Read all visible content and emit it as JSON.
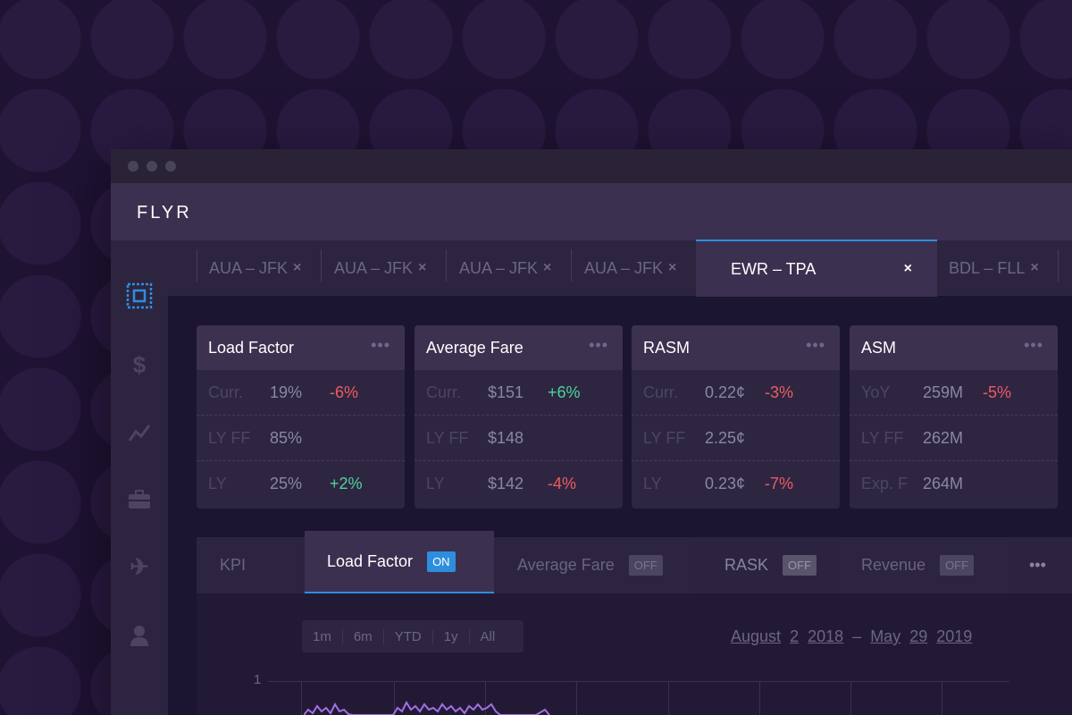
{
  "app": {
    "logo": "FLYR"
  },
  "route_tabs": [
    {
      "label": "AUA – JFK",
      "close": "×"
    },
    {
      "label": "AUA – JFK",
      "close": "×"
    },
    {
      "label": "AUA – JFK",
      "close": "×"
    },
    {
      "label": "AUA – JFK",
      "close": "×"
    },
    {
      "label": "EWR – TPA",
      "close": "×",
      "active": true
    },
    {
      "label": "BDL – FLL",
      "close": "×"
    }
  ],
  "sidebar": {
    "items": [
      {
        "icon": "dashboard-icon",
        "active": true
      },
      {
        "icon": "dollar-icon"
      },
      {
        "icon": "trend-icon"
      },
      {
        "icon": "briefcase-icon"
      },
      {
        "icon": "plane-icon"
      },
      {
        "icon": "user-icon"
      }
    ]
  },
  "cards": [
    {
      "title": "Load Factor",
      "more": "•••",
      "rows": [
        {
          "label": "Curr.",
          "value": "19%",
          "change": "-6%",
          "trend": "neg"
        },
        {
          "label": "LY FF",
          "value": "85%",
          "change": "",
          "trend": ""
        },
        {
          "label": "LY",
          "value": "25%",
          "change": "+2%",
          "trend": "pos"
        }
      ]
    },
    {
      "title": "Average Fare",
      "more": "•••",
      "rows": [
        {
          "label": "Curr.",
          "value": "$151",
          "change": "+6%",
          "trend": "pos"
        },
        {
          "label": "LY FF",
          "value": "$148",
          "change": "",
          "trend": ""
        },
        {
          "label": "LY",
          "value": "$142",
          "change": "-4%",
          "trend": "neg"
        }
      ]
    },
    {
      "title": "RASM",
      "more": "•••",
      "rows": [
        {
          "label": "Curr.",
          "value": "0.22¢",
          "change": "-3%",
          "trend": "neg"
        },
        {
          "label": "LY FF",
          "value": "2.25¢",
          "change": "",
          "trend": ""
        },
        {
          "label": "LY",
          "value": "0.23¢",
          "change": "-7%",
          "trend": "neg"
        }
      ]
    },
    {
      "title": "ASM",
      "more": "•••",
      "rows": [
        {
          "label": "YoY",
          "value": "259M",
          "change": "-5%",
          "trend": "neg"
        },
        {
          "label": "LY FF",
          "value": "262M",
          "change": "",
          "trend": ""
        },
        {
          "label": "Exp. F",
          "value": "264M",
          "change": "",
          "trend": ""
        }
      ]
    }
  ],
  "kpi_tabs": {
    "kpi_label": "KPI",
    "items": [
      {
        "label": "Load Factor",
        "state": "ON"
      },
      {
        "label": "Average Fare",
        "state": "OFF"
      },
      {
        "label": "RASK",
        "state": "OFF"
      },
      {
        "label": "Revenue",
        "state": "OFF"
      }
    ],
    "more": "•••"
  },
  "ranges": [
    "1m",
    "6m",
    "YTD",
    "1y",
    "All"
  ],
  "date_range": {
    "from_month": "August",
    "from_day": "2",
    "from_year": "2018",
    "sep": "–",
    "to_month": "May",
    "to_day": "29",
    "to_year": "2019"
  },
  "chart": {
    "y_tick": "1"
  },
  "colors": {
    "accent": "#2e8ede",
    "negative": "#ee5a64",
    "positive": "#4ed49a",
    "series": "#a56ee6"
  }
}
